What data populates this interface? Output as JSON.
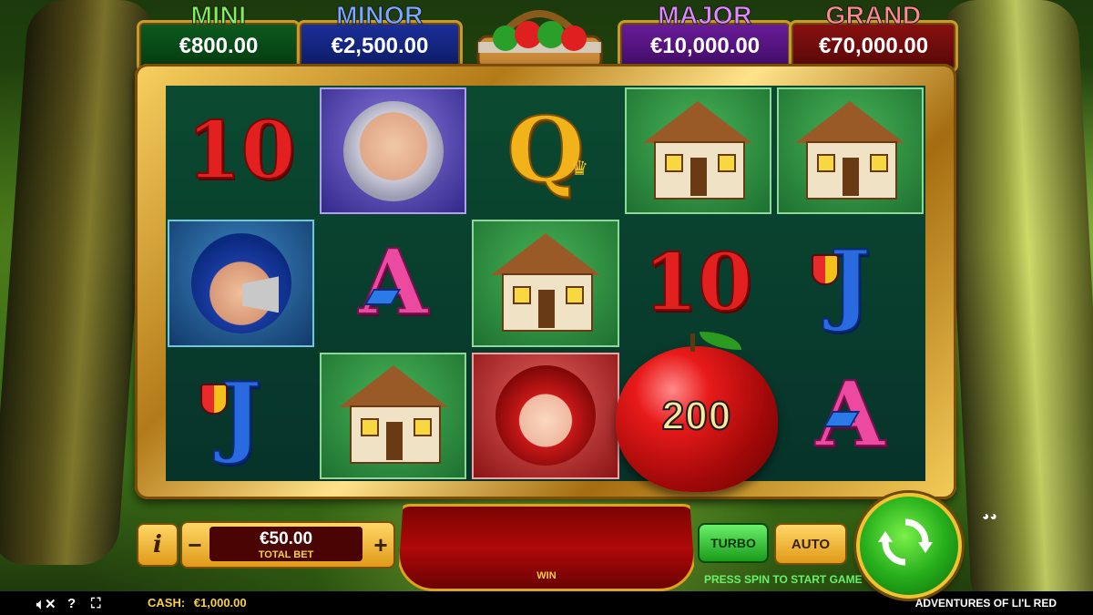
{
  "jackpots": {
    "mini": {
      "label": "MINI",
      "value": "€800.00"
    },
    "minor": {
      "label": "MINOR",
      "value": "€2,500.00"
    },
    "major": {
      "label": "MAJOR",
      "value": "€10,000.00"
    },
    "grand": {
      "label": "GRAND",
      "value": "€70,000.00"
    }
  },
  "reels": {
    "row1": [
      "10",
      "granny",
      "Q",
      "cottage",
      "cottage"
    ],
    "row2": [
      "woodsman",
      "A",
      "cottage",
      "10",
      "J"
    ],
    "row3": [
      "J",
      "cottage",
      "lil-red",
      "apple",
      "A"
    ],
    "symbols": {
      "ten": "10",
      "ace": "A",
      "queen": "Q",
      "jack": "J"
    },
    "apple_value": "200"
  },
  "controls": {
    "info_label": "i",
    "minus_label": "−",
    "plus_label": "+",
    "bet_amount": "€50.00",
    "bet_label": "TOTAL BET",
    "win_label": "WIN",
    "turbo_label": "TURBO",
    "auto_label": "AUTO",
    "press_message": "PRESS SPIN TO START GAME"
  },
  "status": {
    "cash_label": "CASH:",
    "cash_value": "€1,000.00",
    "game_name": "ADVENTURES OF LI'L RED"
  },
  "icons": [
    "mute-icon",
    "help-icon",
    "fullscreen-icon",
    "spin-icon",
    "info-icon"
  ],
  "colors": {
    "gold": "#e0a21a",
    "spin_green": "#28b01c",
    "win_red": "#b00808"
  }
}
